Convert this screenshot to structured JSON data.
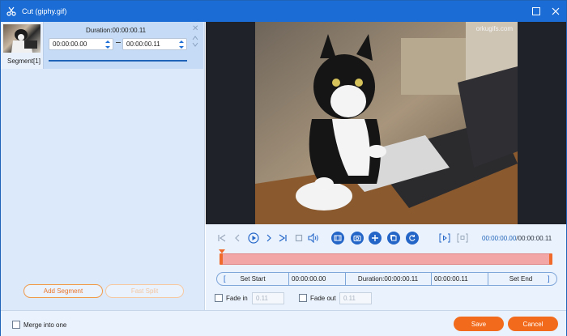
{
  "window": {
    "title": "Cut (giphy.gif)"
  },
  "segment": {
    "label": "Segment[1]",
    "duration": "Duration:00:00:00.11",
    "start": "00:00:00.00",
    "end": "00:00:00.11"
  },
  "left_buttons": {
    "add_segment": "Add Segment",
    "fast_split": "Fast Split"
  },
  "preview": {
    "watermark": "orkugifs.com"
  },
  "player": {
    "current": "00:00:00.00",
    "total": "/00:00:00.11"
  },
  "cut_bar": {
    "set_start": "Set Start",
    "start_time": "00:00:00.00",
    "duration": "Duration:00:00:00.11",
    "end_time": "00:00:00.11",
    "set_end": "Set End"
  },
  "fade": {
    "fade_in_label": "Fade in",
    "fade_in_value": "0.11",
    "fade_out_label": "Fade out",
    "fade_out_value": "0.11"
  },
  "footer": {
    "merge_label": "Merge into one",
    "save": "Save",
    "cancel": "Cancel"
  },
  "colors": {
    "accent": "#1b6cd4",
    "orange": "#f26a1b"
  }
}
